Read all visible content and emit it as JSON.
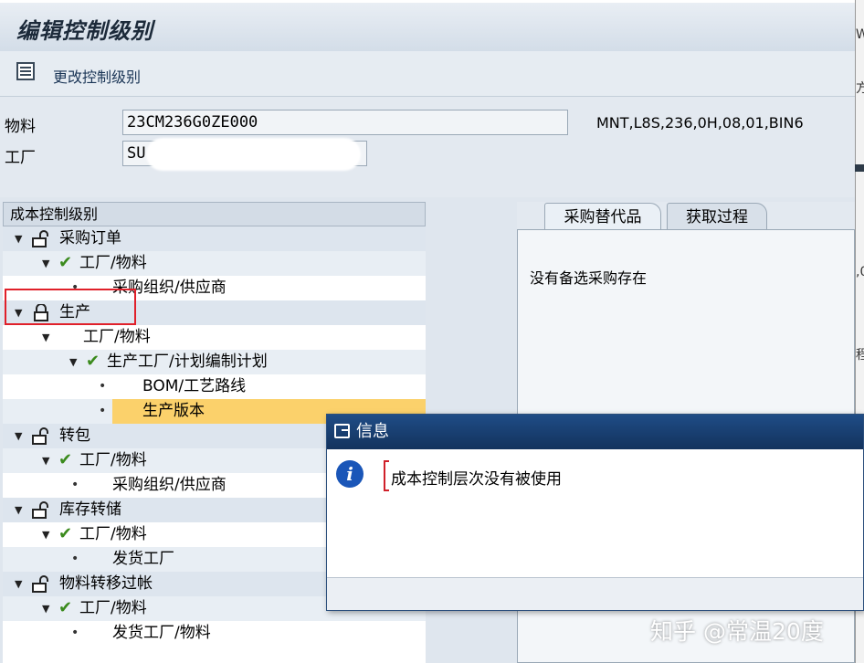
{
  "window": {
    "title": "编辑控制级别"
  },
  "toolbar": {
    "change_label": "更改控制级别"
  },
  "header": {
    "material_label": "物料",
    "material_value": "23CM236G0ZE000",
    "material_desc": "MNT,L8S,236,0H,08,01,BIN6",
    "plant_label": "工厂",
    "plant_value": "SU"
  },
  "tree": {
    "title": "成本控制级别",
    "rows": [
      {
        "text": "采购订单",
        "level": 0,
        "icon": "lock-open-icon",
        "expand": true
      },
      {
        "text": "工厂/物料",
        "level": 1,
        "icon": "checkmark-icon",
        "expand": true
      },
      {
        "text": "采购组织/供应商",
        "level": 2,
        "icon": "bullet",
        "expand": false
      },
      {
        "text": "生产",
        "level": 0,
        "icon": "lock-closed-icon",
        "expand": true
      },
      {
        "text": "工厂/物料",
        "level": 1,
        "icon": "none",
        "expand": true
      },
      {
        "text": "生产工厂/计划编制计划",
        "level": 2,
        "icon": "checkmark-icon",
        "expand": true
      },
      {
        "text": "BOM/工艺路线",
        "level": 3,
        "icon": "bullet",
        "expand": false
      },
      {
        "text": "生产版本",
        "level": 3,
        "icon": "bullet",
        "expand": false,
        "selected": true
      },
      {
        "text": "转包",
        "level": 0,
        "icon": "lock-open-icon",
        "expand": true
      },
      {
        "text": "工厂/物料",
        "level": 1,
        "icon": "checkmark-icon",
        "expand": true
      },
      {
        "text": "采购组织/供应商",
        "level": 2,
        "icon": "bullet",
        "expand": false
      },
      {
        "text": "库存转储",
        "level": 0,
        "icon": "lock-open-icon",
        "expand": true
      },
      {
        "text": "工厂/物料",
        "level": 1,
        "icon": "checkmark-icon",
        "expand": true
      },
      {
        "text": "发货工厂",
        "level": 2,
        "icon": "bullet",
        "expand": false
      },
      {
        "text": "物料转移过帐",
        "level": 0,
        "icon": "lock-open-icon",
        "expand": true
      },
      {
        "text": "工厂/物料",
        "level": 1,
        "icon": "checkmark-icon",
        "expand": true
      },
      {
        "text": "发货工厂/物料",
        "level": 2,
        "icon": "bullet",
        "expand": false
      }
    ]
  },
  "tabs": [
    {
      "label": "采购替代品",
      "active": true
    },
    {
      "label": "获取过程",
      "active": false
    }
  ],
  "panel": {
    "empty_text": "没有备选采购存在"
  },
  "dialog": {
    "title": "信息",
    "message": "成本控制层次没有被使用"
  },
  "watermark": "知乎 @常温20度",
  "right_strip": {
    "text1": "W",
    "text2": "方",
    "text3": ",0",
    "text4": "程"
  },
  "colors": {
    "selection": "#fbd16b",
    "dialog_title": "#1f4c86",
    "highlight_box": "#e0202a",
    "check": "#3a8a1c"
  }
}
